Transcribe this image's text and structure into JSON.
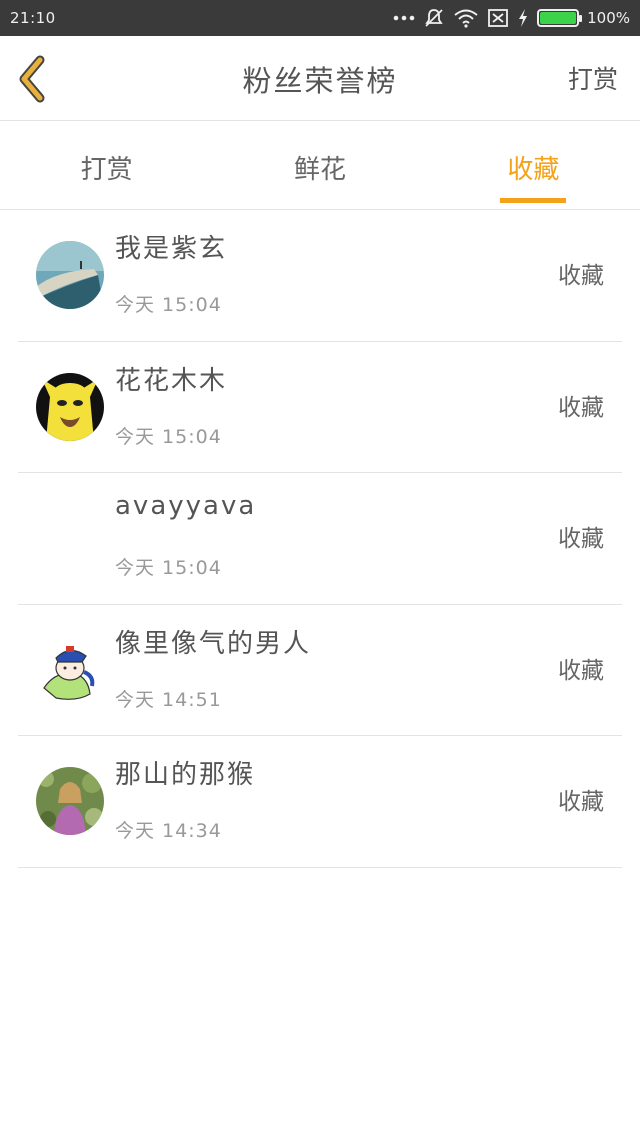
{
  "status_bar": {
    "time": "21:10",
    "battery_percent": "100%",
    "battery_level": 1.0,
    "icons": [
      "more-dots-icon",
      "mute-notification-icon",
      "wifi-icon",
      "sim-error-icon",
      "charging-icon",
      "battery-icon"
    ],
    "battery_color": "#3cd24a"
  },
  "header": {
    "title": "粉丝荣誉榜",
    "right_action": "打赏",
    "back_icon": "chevron-left-icon",
    "back_icon_color": "#e8b23a"
  },
  "tabs": [
    {
      "label": "打赏",
      "active": false
    },
    {
      "label": "鲜花",
      "active": false
    },
    {
      "label": "收藏",
      "active": true
    }
  ],
  "accent_color": "#f3a21a",
  "list": [
    {
      "name": "我是紫玄",
      "time": "今天 15:04",
      "action": "收藏",
      "avatar": "avatar-cliff-photo"
    },
    {
      "name": "花花木木",
      "time": "今天 15:04",
      "action": "收藏",
      "avatar": "avatar-yellow-cartoon"
    },
    {
      "name": "avayyava",
      "time": "今天 15:04",
      "action": "收藏",
      "avatar": "avatar-empty"
    },
    {
      "name": "像里像气的男人",
      "time": "今天 14:51",
      "action": "收藏",
      "avatar": "avatar-anime-character"
    },
    {
      "name": "那山的那猴",
      "time": "今天 14:34",
      "action": "收藏",
      "avatar": "avatar-girl-photo"
    }
  ]
}
